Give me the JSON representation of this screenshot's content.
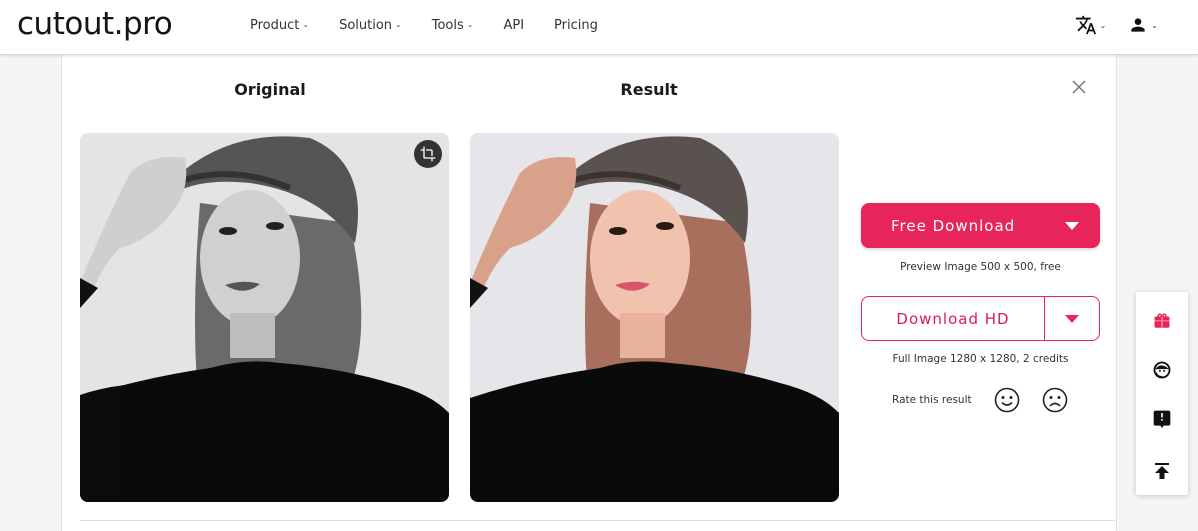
{
  "header": {
    "logo": "cutout.pro",
    "nav": [
      {
        "label": "Product",
        "has_dropdown": true
      },
      {
        "label": "Solution",
        "has_dropdown": true
      },
      {
        "label": "Tools",
        "has_dropdown": true
      },
      {
        "label": "API",
        "has_dropdown": false
      },
      {
        "label": "Pricing",
        "has_dropdown": false
      }
    ],
    "right_icons": [
      "translate-icon",
      "user-icon"
    ]
  },
  "modal": {
    "original_title": "Original",
    "result_title": "Result",
    "close_icon": "close-icon",
    "crop_icon": "crop-icon"
  },
  "actions": {
    "free_download_label": "Free Download",
    "free_caption": "Preview Image 500 x 500, free",
    "hd_download_label": "Download HD",
    "hd_caption": "Full Image 1280 x 1280, 2 credits",
    "rate_label": "Rate this result"
  },
  "side_toolbar": [
    "gift-icon",
    "support-icon",
    "feedback-icon",
    "back-to-top-icon"
  ],
  "colors": {
    "accent": "#e8255a",
    "text": "#222222"
  }
}
